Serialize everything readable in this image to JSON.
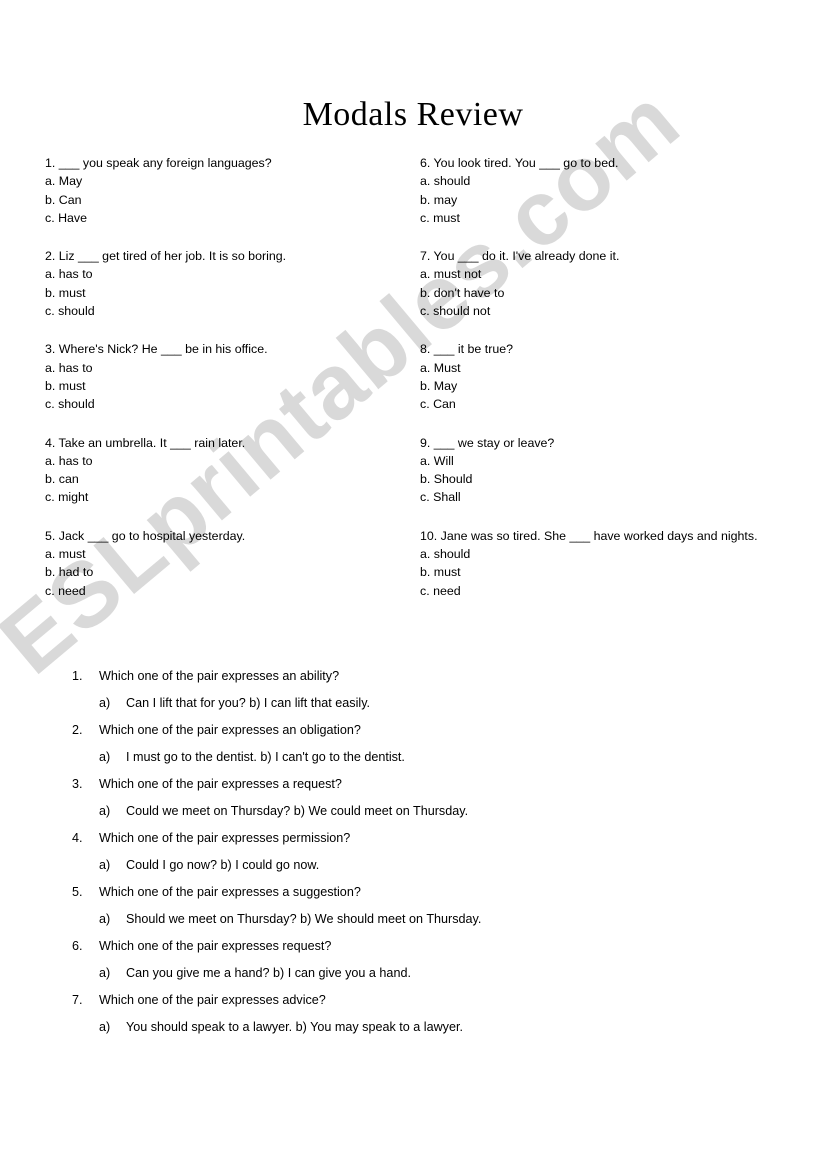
{
  "document": {
    "title": "Modals Review",
    "watermark": "ESLprintables.com",
    "watermark_color": "#8c8c8c"
  },
  "mcq": {
    "left_column": [
      {
        "stem": "1. ___ you speak any foreign languages?",
        "options": [
          "a. May",
          "b. Can",
          "c. Have"
        ]
      },
      {
        "stem": "2. Liz ___ get tired of her job. It is so boring.",
        "options": [
          "a. has to",
          "b. must",
          "c. should"
        ]
      },
      {
        "stem": "3. Where's Nick? He ___ be in his office.",
        "options": [
          "a. has to",
          "b. must",
          "c. should"
        ]
      },
      {
        "stem": "4. Take an umbrella. It ___ rain later.",
        "options": [
          "a. has to",
          "b. can",
          "c. might"
        ]
      },
      {
        "stem": "5. Jack ___ go to hospital yesterday.",
        "options": [
          "a. must",
          "b. had to",
          "c. need"
        ]
      }
    ],
    "right_column": [
      {
        "stem": "6. You look tired. You ___ go to bed.",
        "options": [
          "a. should",
          "b. may",
          "c. must"
        ]
      },
      {
        "stem": "7. You ___ do it. I've already done it.",
        "options": [
          "a. must not",
          "b. don't have to",
          "c. should not"
        ]
      },
      {
        "stem": "8. ___ it be true?",
        "options": [
          "a. Must",
          "b. May",
          "c. Can"
        ]
      },
      {
        "stem": "9. ___ we stay or leave?",
        "options": [
          "a. Will",
          "b. Should",
          "c. Shall"
        ]
      },
      {
        "stem": "10. Jane was so tired. She ___ have worked days and nights.",
        "options": [
          "a. should",
          "b. must",
          "c. need"
        ]
      }
    ]
  },
  "pairs": [
    {
      "number": "1.",
      "question": "Which one of the pair expresses an ability?",
      "answer_marker": "a)",
      "answer": "Can I lift that for you? b) I can lift that easily."
    },
    {
      "number": "2.",
      "question": "Which one of the pair expresses an obligation?",
      "answer_marker": "a)",
      "answer": "I must go to the dentist. b) I can't go to the dentist."
    },
    {
      "number": "3.",
      "question": "Which one of the pair expresses a request?",
      "answer_marker": "a)",
      "answer": "Could we meet on Thursday? b) We could meet on Thursday."
    },
    {
      "number": "4.",
      "question": "Which one of the pair expresses permission?",
      "answer_marker": "a)",
      "answer": "Could I go now? b) I could go now."
    },
    {
      "number": "5.",
      "question": "Which one of the pair expresses a suggestion?",
      "answer_marker": "a)",
      "answer": "Should we meet on Thursday? b) We should meet on Thursday."
    },
    {
      "number": "6.",
      "question": "Which one of the pair expresses request?",
      "answer_marker": "a)",
      "answer": "Can you give me a hand? b) I can give you a hand."
    },
    {
      "number": "7.",
      "question": "Which one of the pair expresses advice?",
      "answer_marker": "a)",
      "answer": "You should speak to a lawyer. b) You may speak to a lawyer."
    }
  ]
}
